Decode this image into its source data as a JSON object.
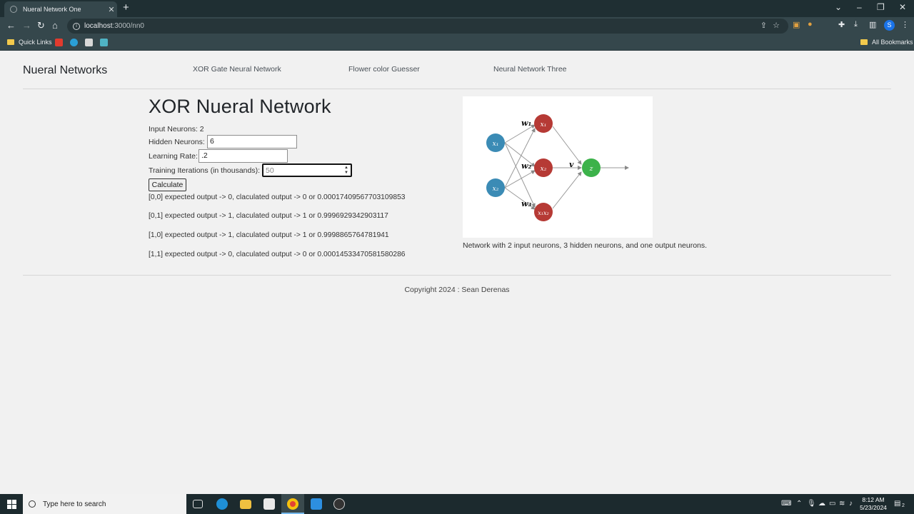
{
  "browser": {
    "tab_title": "Nueral Network One",
    "tab_close": "✕",
    "new_tab": "+",
    "url_host": "localhost",
    "url_path": ":3000/nn0",
    "bookmarks_label": "Quick Links",
    "all_bookmarks": "All Bookmarks",
    "profile_initial": "S"
  },
  "nav": {
    "brand": "Nueral Networks",
    "links": [
      "XOR Gate Neural Network",
      "Flower color Guesser",
      "Neural Network Three"
    ]
  },
  "main": {
    "title": "XOR Nueral Network",
    "input_neurons_label": "Input Neurons: 2",
    "hidden_neurons_label": "Hidden Neurons:",
    "hidden_neurons_value": "6",
    "learning_rate_label": "Learning Rate:",
    "learning_rate_value": ".2",
    "iterations_label": "Training Iterations (in thousands):",
    "iterations_value": "50",
    "calculate_label": "Calculate",
    "results": [
      "[0,0] expected output -> 0, claculated output -> 0 or 0.00017409567703109853",
      "[0,1] expected output -> 1, claculated output -> 1 or 0.9996929342903117",
      "[1,0] expected output -> 1, claculated output -> 1 or 0.9998865764781941",
      "[1,1] expected output -> 0, claculated output -> 0 or 0.00014533470581580286"
    ]
  },
  "diagram": {
    "input_labels": [
      "x₁",
      "x₂"
    ],
    "hidden_labels": [
      "x₁",
      "x₂",
      "x₁x₂"
    ],
    "output_label": "z",
    "weight_labels": [
      "w₁",
      "w₂",
      "w₃"
    ],
    "v_label": "v",
    "colors": {
      "input": "#3b8bb5",
      "hidden": "#b63a35",
      "output": "#3cb24a"
    },
    "caption": "Network with 2 input neurons, 3 hidden neurons, and one output neurons."
  },
  "footer": {
    "copyright": "Copyright 2024 : Sean Derenas"
  },
  "taskbar": {
    "search_placeholder": "Type here to search",
    "time": "8:12 AM",
    "date": "5/23/2024",
    "notification_count": "2"
  }
}
